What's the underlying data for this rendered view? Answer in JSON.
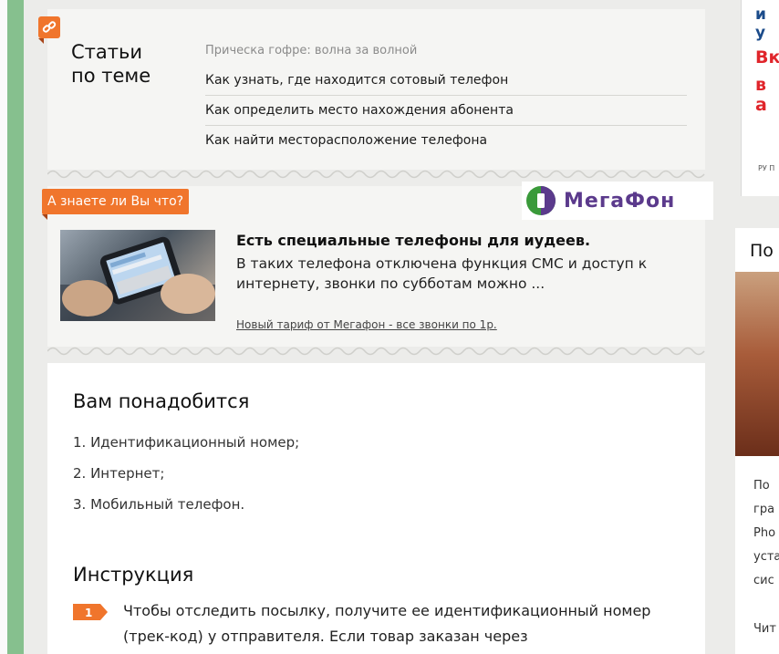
{
  "related": {
    "title_line1": "Статьи",
    "title_line2": "по теме",
    "first_link": "Прическа гофре: волна за волной",
    "links": [
      "Как узнать, где находится сотовый телефон",
      "Как определить место нахождения абонента",
      "Как найти месторасположение телефона"
    ]
  },
  "didyouknow": {
    "label": "А знаете ли Вы что?",
    "brand": "МегаФон",
    "title": "Есть специальные телефоны для иудеев.",
    "text": "В таких телефона отключена функция СМС и доступ к интернету, звонки по субботам можно ...",
    "link": "Новый тариф от Мегафон - все звонки по 1р."
  },
  "content": {
    "need_title": "Вам понадобится",
    "need_items": [
      "1. Идентификационный номер;",
      "2. Интернет;",
      "3. Мобильный телефон."
    ],
    "instr_title": "Инструкция",
    "step_number": "1",
    "step_text": "Чтобы отследить посылку, получите ее идентификационный номер (трек-код) у отправителя. Если товар заказан через"
  },
  "right_ad": {
    "line1": "и у",
    "line2": "Вк",
    "line3": "в а",
    "foot": "РУ П"
  },
  "right_card": {
    "title": "По",
    "text_lines": [
      "По",
      "гра",
      "Pho",
      "уста",
      "сис"
    ],
    "read": "Чит"
  },
  "colors": {
    "accent_orange": "#f0752c",
    "green_stripe": "#86c08e",
    "megafon_purple": "#5b3a8c"
  }
}
